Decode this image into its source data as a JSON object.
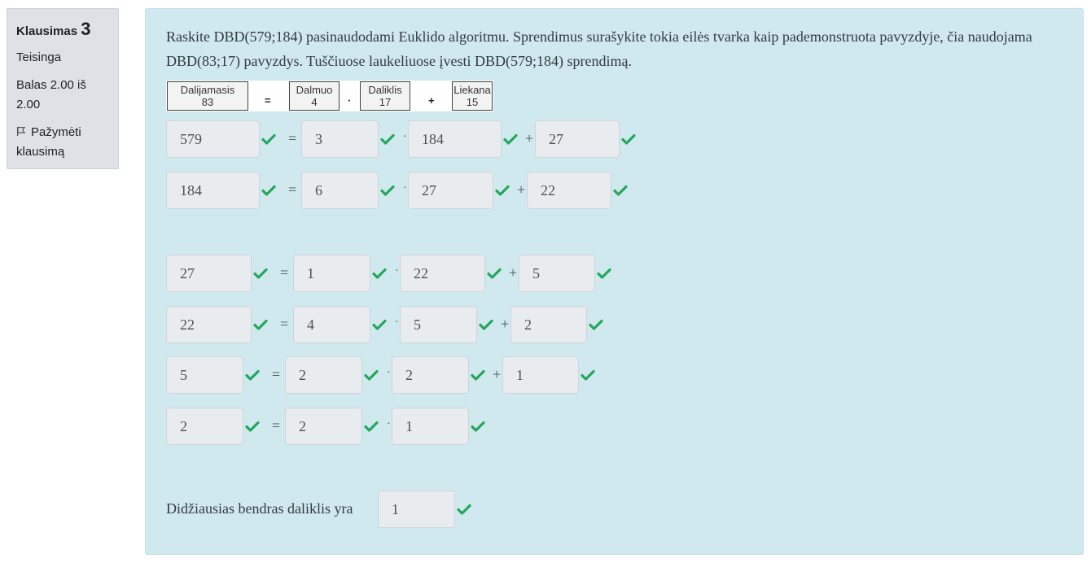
{
  "info": {
    "question_label": "Klausimas",
    "question_number": "3",
    "state": "Teisinga",
    "grade": "Balas 2.00 iš 2.00",
    "flag_label": "Pažymėti klausimą"
  },
  "question": {
    "text": "Raskite DBD(579;184) pasinaudodami Euklido algoritmu. Sprendimus surašykite tokia eilės tvarka kaip pademonstruota pavyzdyje, čia naudojama DBD(83;17) pavyzdys. Tuščiuose laukeliuose įvesti DBD(579;184) sprendimą."
  },
  "example": {
    "dividend_label": "Dalijamasis",
    "dividend_value": "83",
    "equals": "=",
    "quotient_label": "Dalmuo",
    "quotient_value": "4",
    "times": "·",
    "divisor_label": "Daliklis",
    "divisor_value": "17",
    "plus": "+",
    "remainder_label": "Liekana",
    "remainder_value": "15"
  },
  "rows": [
    {
      "dividend": "579",
      "quotient": "3",
      "divisor": "184",
      "remainder": "27"
    },
    {
      "dividend": "184",
      "quotient": "6",
      "divisor": "27",
      "remainder": "22"
    },
    {
      "dividend": "27",
      "quotient": "1",
      "divisor": "22",
      "remainder": "5"
    },
    {
      "dividend": "22",
      "quotient": "4",
      "divisor": "5",
      "remainder": "2"
    },
    {
      "dividend": "5",
      "quotient": "2",
      "divisor": "2",
      "remainder": "1"
    },
    {
      "dividend": "2",
      "quotient": "2",
      "divisor": "1"
    }
  ],
  "operators": {
    "equals": "=",
    "times": "·",
    "plus": "+"
  },
  "final": {
    "label": "Didžiausias bendras daliklis yra",
    "value": "1"
  },
  "colors": {
    "correct": "#26a65b",
    "panel_bg": "#d0e9ef",
    "field_bg": "#e9ecef"
  },
  "icons": {
    "correct": "check-icon",
    "flag": "flag-icon"
  }
}
